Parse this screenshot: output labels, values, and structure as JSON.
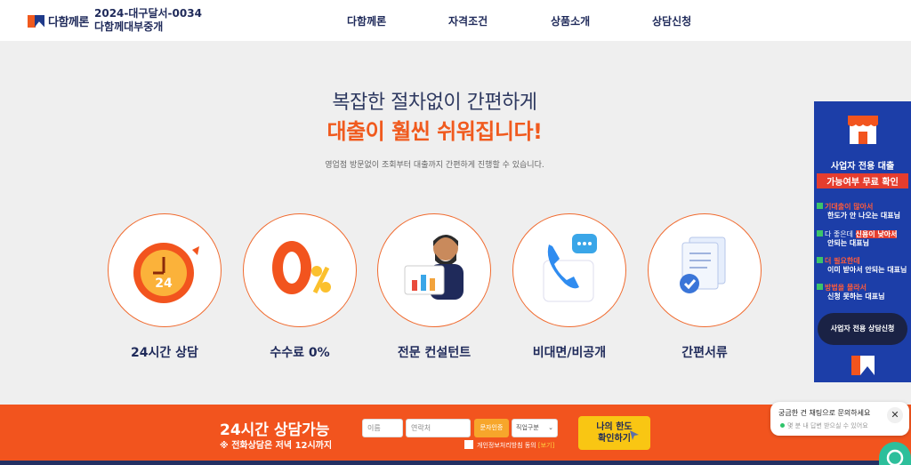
{
  "header": {
    "logo_text": "다함께론",
    "reg_line1": "2024-대구달서-0034",
    "reg_line2": "다함께대부중개",
    "nav": [
      "다함께론",
      "자격조건",
      "상품소개",
      "상담신청"
    ]
  },
  "hero": {
    "line1": "복잡한 절차없이 간편하게",
    "line2": "대출이 훨씬 쉬워집니다!",
    "sub": "영업점 방문없이 조회부터 대출까지 간편하게 진행할 수 있습니다."
  },
  "features": [
    {
      "label": "24시간 상담",
      "icon": "clock-24-icon",
      "badge": "24"
    },
    {
      "label": "수수료 0%",
      "icon": "zero-percent-icon",
      "badge": "0"
    },
    {
      "label": "전문 컨설턴트",
      "icon": "consultant-icon"
    },
    {
      "label": "비대면/비공개",
      "icon": "phone-chat-icon"
    },
    {
      "label": "간편서류",
      "icon": "documents-icon"
    }
  ],
  "bottom_bar": {
    "title": "24시간 상담가능",
    "sub": "※ 전화상담은 저녁 12시까지",
    "name_placeholder": "이름",
    "phone_placeholder": "연락처",
    "auth_button": "문자인증",
    "job_select": "직업구분",
    "privacy_label": "개인정보처리방침 동의",
    "privacy_view": "[보기]",
    "limit_button_line1": "나의 한도",
    "limit_button_line2": "확인하기"
  },
  "side_banner": {
    "title": "사업자 전용 대출",
    "subtitle": "가능여부 무료 확인",
    "items": [
      {
        "head": "기대출이 많아서",
        "detail": "한도가 안 나오는 대표님"
      },
      {
        "head_pre": "다 좋은데 ",
        "head_hl": "신용이 낮아서",
        "detail": "안되는 대표님"
      },
      {
        "head": "더 필요한데",
        "detail": "이미 받아서 안되는 대표님"
      },
      {
        "head": "방법을 몰라서",
        "detail": "신청 못하는 대표님"
      }
    ],
    "button": "사업자 전용 상담신청"
  },
  "chat": {
    "title": "궁금한 건 채팅으로 문의하세요",
    "status": "몇 분 내 답변 받으실 수 있어요",
    "close": "✕"
  },
  "colors": {
    "accent": "#f05a1e",
    "navy": "#1f2a5a",
    "banner_blue": "#1c3ea8",
    "cta_yellow": "#f9c613"
  }
}
